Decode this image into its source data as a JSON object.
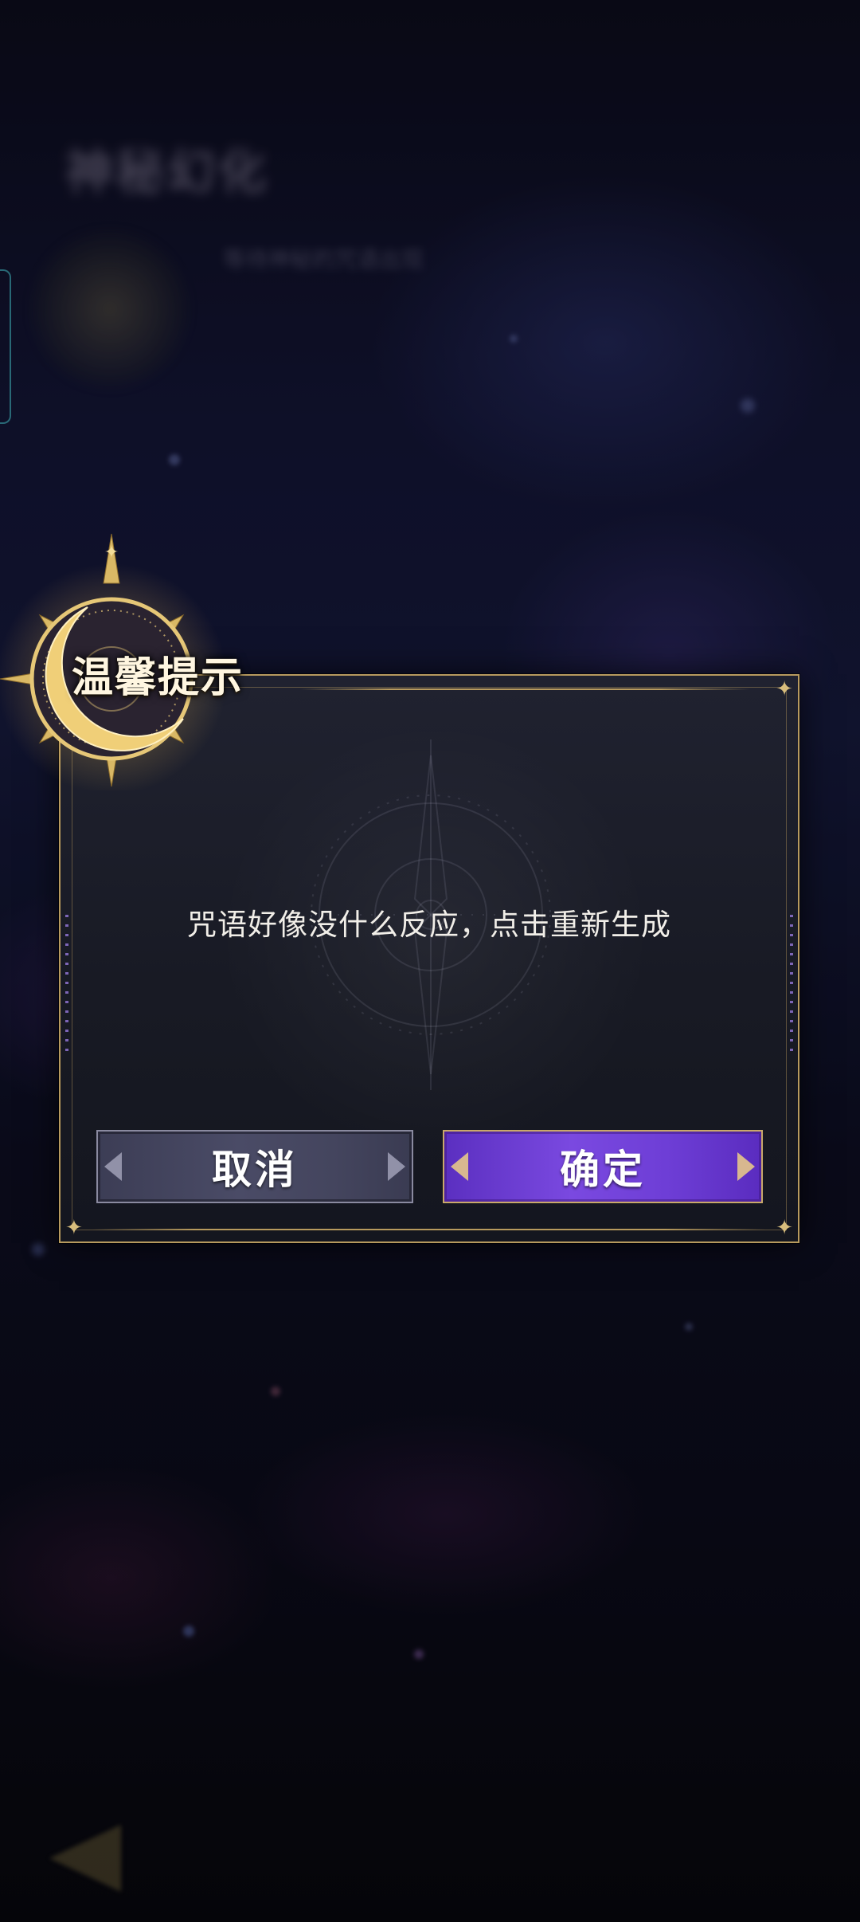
{
  "background": {
    "title": "神秘幻化",
    "subtitle": "等待神秘的咒语出现"
  },
  "dialog": {
    "title": "温馨提示",
    "message": "咒语好像没什么反应，点击重新生成",
    "cancel_label": "取消",
    "confirm_label": "确定"
  },
  "colors": {
    "frame_gold": "#b79a5e",
    "confirm_purple": "#7a49e0",
    "cancel_gray": "#4a4b66",
    "background": "#0b0b18"
  },
  "icons": {
    "emblem": "crescent-moon-sun-emblem-icon",
    "back": "back-arrow-icon"
  }
}
